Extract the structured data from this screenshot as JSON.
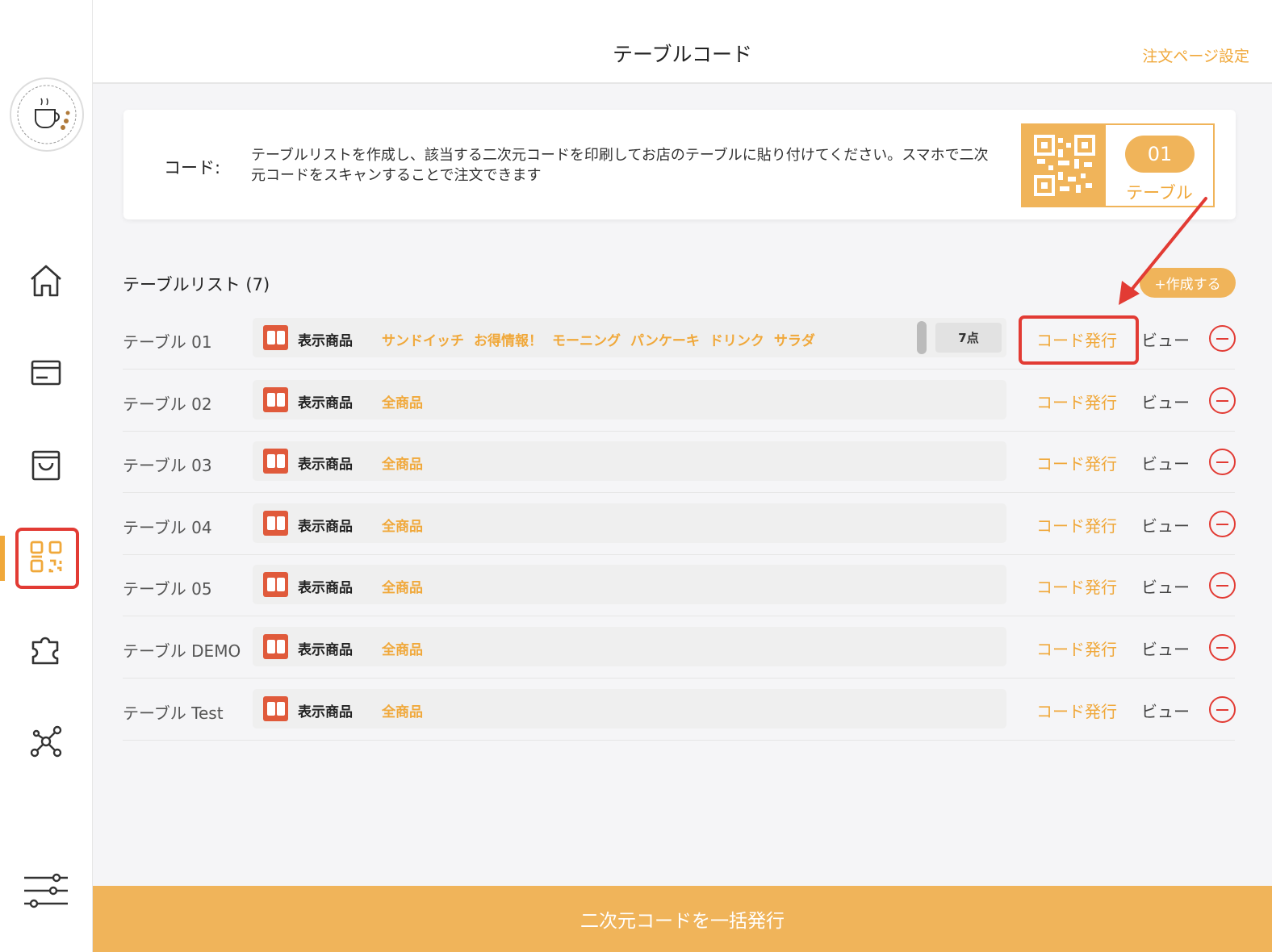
{
  "header": {
    "title": "テーブルコード",
    "settings_link": "注文ページ設定"
  },
  "info": {
    "label": "コード:",
    "description": "テーブルリストを作成し、該当する二次元コードを印刷してお店のテーブルに貼り付けてください。スマホで二次元コードをスキャンすることで注文できます",
    "sample_number": "01",
    "sample_label": "テーブル"
  },
  "list": {
    "title": "テーブルリスト (7)",
    "create_label": "+作成する",
    "product_label": "表示商品",
    "issue_label": "コード発行",
    "view_label": "ビュー",
    "rows": [
      {
        "name": "テーブル 01",
        "categories": [
          "サンドイッチ",
          "お得情報！",
          "モーニング",
          "パンケーキ",
          "ドリンク",
          "サラダ"
        ],
        "count": "7点"
      },
      {
        "name": "テーブル 02",
        "categories": [
          "全商品"
        ]
      },
      {
        "name": "テーブル 03",
        "categories": [
          "全商品"
        ]
      },
      {
        "name": "テーブル 04",
        "categories": [
          "全商品"
        ]
      },
      {
        "name": "テーブル 05",
        "categories": [
          "全商品"
        ]
      },
      {
        "name": "テーブル DEMO",
        "categories": [
          "全商品"
        ]
      },
      {
        "name": "テーブル Test",
        "categories": [
          "全商品"
        ]
      }
    ]
  },
  "footer": {
    "bulk_issue_label": "二次元コードを一括発行"
  },
  "sidebar": {
    "items": [
      "home-icon",
      "card-icon",
      "bag-icon",
      "qr-code-icon",
      "puzzle-icon",
      "network-icon"
    ],
    "active": "qr-code-icon",
    "bottom": "sliders-icon"
  },
  "colors": {
    "accent": "#f0b45a",
    "accent_text": "#f0a83a",
    "danger": "#e23b34"
  }
}
